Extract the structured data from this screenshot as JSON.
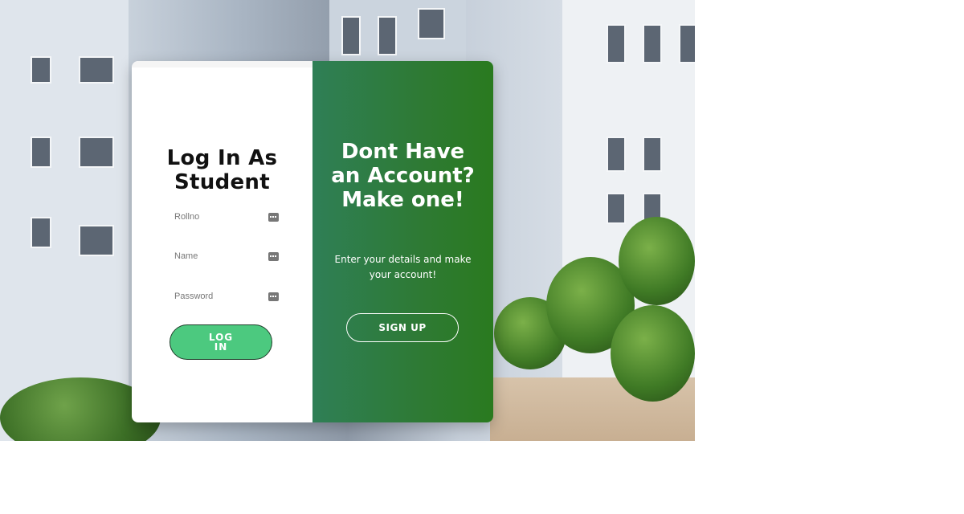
{
  "login": {
    "title": "Log In As Student",
    "fields": [
      {
        "label": "Rollno",
        "icon": "keyboard-icon"
      },
      {
        "label": "Name",
        "icon": "keyboard-icon"
      },
      {
        "label": "Password",
        "icon": "keyboard-icon"
      }
    ],
    "button_label": "LOG IN"
  },
  "signup_panel": {
    "title": "Dont Have an Account? Make one!",
    "description": "Enter your details and make your account!",
    "button_label": "SIGN UP"
  },
  "colors": {
    "login_button": "#4cc97f",
    "panel_gradient_start": "#2f7f56",
    "panel_gradient_end": "#2a7a1f"
  }
}
